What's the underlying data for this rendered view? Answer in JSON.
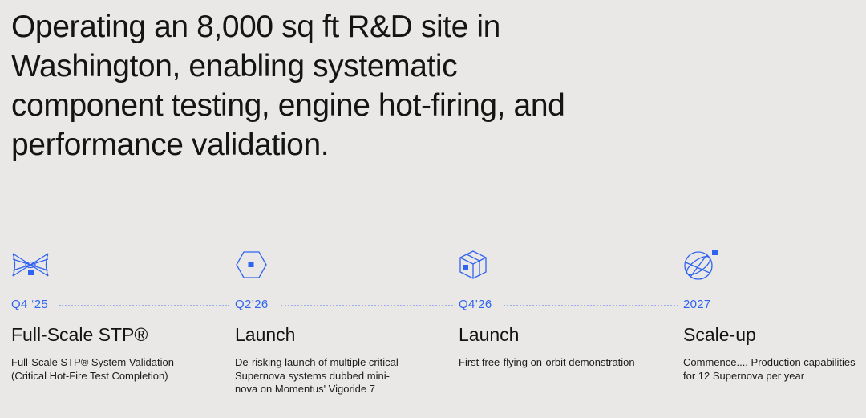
{
  "headline": "Operating an 8,000 sq ft R&D site in Washington, enabling systematic component testing, engine hot-firing, and performance validation.",
  "colors": {
    "accent": "#2f64f0",
    "background": "#e9e8e6",
    "text": "#141414"
  },
  "milestones": [
    {
      "icon": "engine-nozzle-icon",
      "date": "Q4 ‘25",
      "title": "Full-Scale STP®",
      "description": "Full-Scale STP® System Validation (Critical Hot-Fire Test Completion)"
    },
    {
      "icon": "hexagon-core-icon",
      "date": "Q2’26",
      "title": "Launch",
      "description": "De-risking launch of multiple critical Supernova systems dubbed mini-nova on Momentus' Vigoride 7"
    },
    {
      "icon": "cube-satellite-icon",
      "date": "Q4’26",
      "title": "Launch",
      "description": "First free-flying on-orbit demonstration"
    },
    {
      "icon": "orbit-globe-icon",
      "date": "2027",
      "title": "Scale-up",
      "description": "Commence.... Production capabilities for 12 Supernova per year"
    }
  ]
}
